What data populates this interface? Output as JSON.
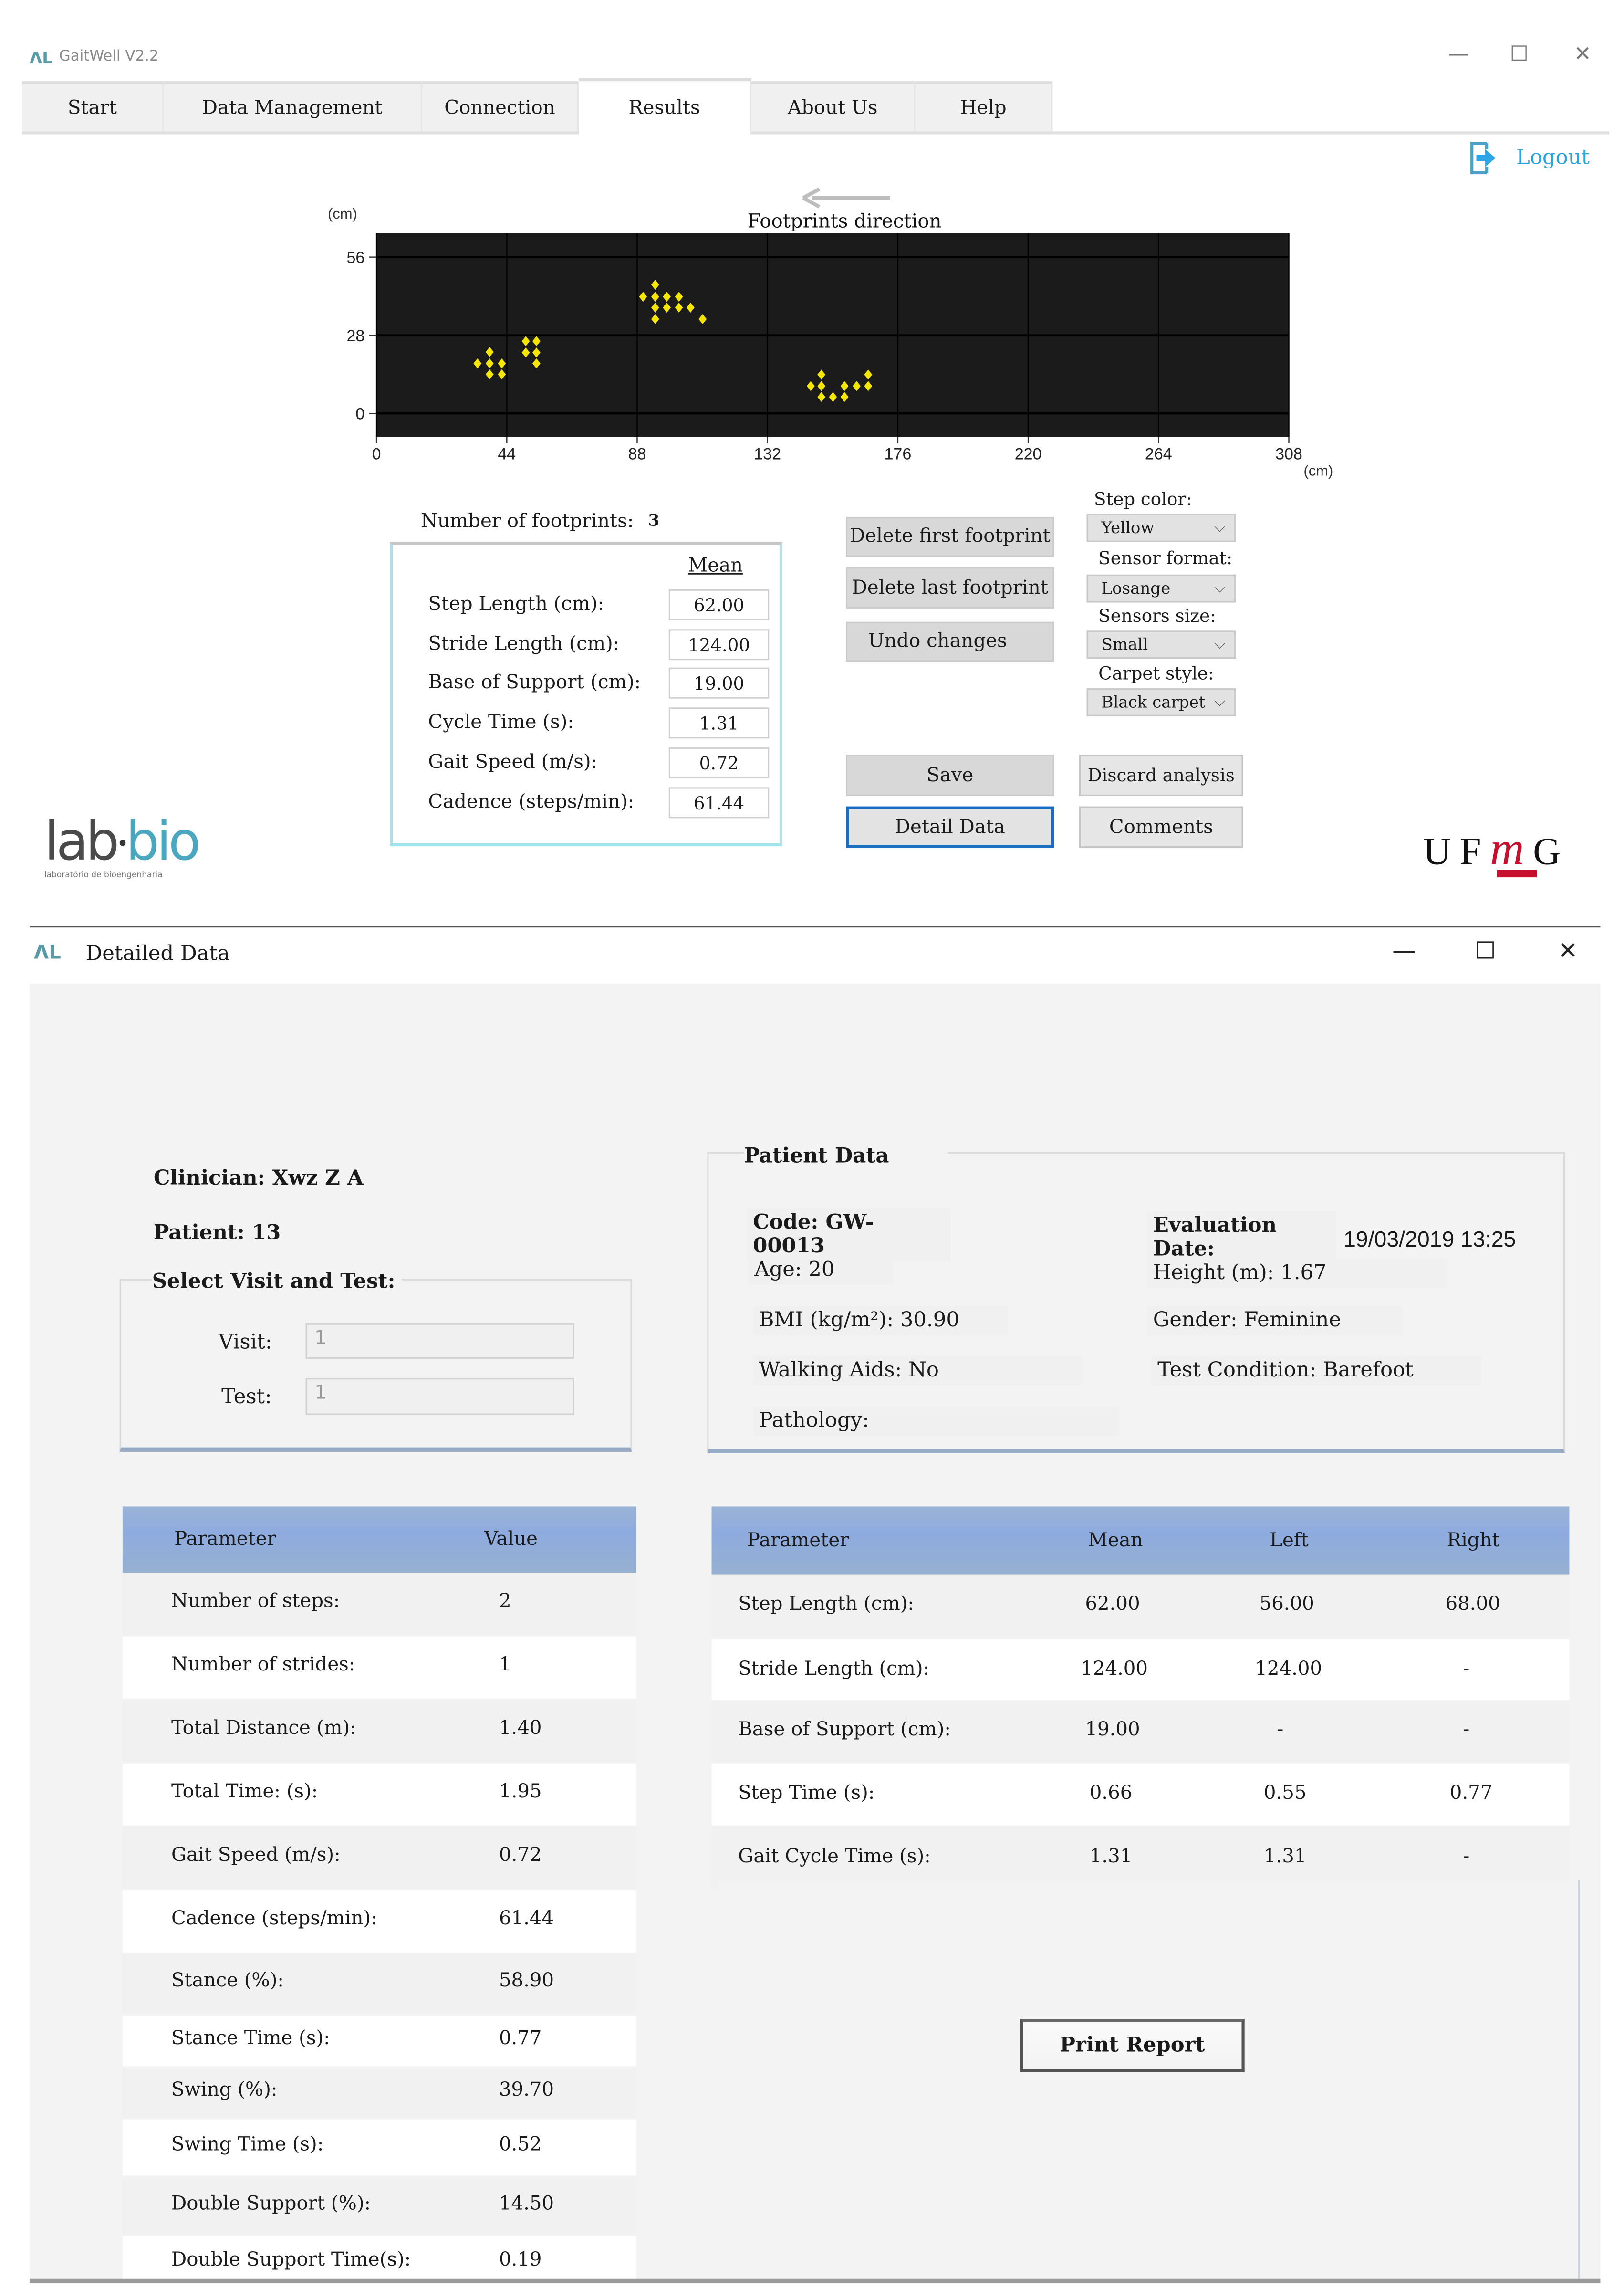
{
  "main_window": {
    "title": "GaitWell V2.2",
    "logo_glyph": "ΛL",
    "controls": {
      "minimize": "—",
      "maximize": "☐",
      "close": "✕"
    },
    "tabs": [
      {
        "label": "Start",
        "active": false
      },
      {
        "label": "Data Management",
        "active": false
      },
      {
        "label": "Connection",
        "active": false
      },
      {
        "label": "Results",
        "active": true
      },
      {
        "label": "About Us",
        "active": false
      },
      {
        "label": "Help",
        "active": false
      }
    ],
    "logout_label": "Logout",
    "footprint_count_label": "Number of footprints:",
    "footprint_count_value": "3",
    "mean_header": "Mean",
    "mean_fields": [
      {
        "label": "Step Length (cm):",
        "value": "62.00"
      },
      {
        "label": "Stride Length (cm):",
        "value": "124.00"
      },
      {
        "label": "Base of Support (cm):",
        "value": "19.00"
      },
      {
        "label": "Cycle Time (s):",
        "value": "1.31"
      },
      {
        "label": "Gait Speed (m/s):",
        "value": "0.72"
      },
      {
        "label": "Cadence (steps/min):",
        "value": "61.44"
      }
    ],
    "buttons": {
      "delete_first": "Delete first footprint",
      "delete_last": "Delete last footprint",
      "undo": "Undo changes",
      "save": "Save",
      "detail_data": "Detail Data",
      "discard": "Discard analysis",
      "comments": "Comments"
    },
    "options": [
      {
        "label": "Step color:",
        "value": "Yellow"
      },
      {
        "label": "Sensor format:",
        "value": "Losange"
      },
      {
        "label": "Sensors size:",
        "value": "Small"
      },
      {
        "label": "Carpet style:",
        "value": "Black carpet"
      }
    ],
    "logos": {
      "labbio_lab": "lab",
      "labbio_dot": "•",
      "labbio_bio": "bio",
      "labbio_sub": "laboratório de bioengenharia",
      "ufmg_u": "U",
      "ufmg_f": "F",
      "ufmg_m": "m",
      "ufmg_g": "G"
    },
    "colors": {
      "accent": "#29a3dc",
      "step": "#f5e600",
      "carpet": "#1b1b1b",
      "ufmg_red": "#c8102e"
    }
  },
  "chart_data": {
    "type": "scatter",
    "title": "Footprints direction",
    "direction_arrow": "←",
    "xlabel": "(cm)",
    "ylabel": "(cm)",
    "xlim": [
      0,
      308
    ],
    "ylim": [
      -8.5,
      64.5
    ],
    "xticks": [
      0,
      44,
      88,
      132,
      176,
      220,
      264,
      308
    ],
    "yticks": [
      0,
      28,
      56
    ],
    "grid": true,
    "marker": "diamond",
    "marker_color": "#f5e600",
    "background": "#1b1b1b",
    "series": [
      {
        "name": "footprint-1",
        "points": [
          [
            34.1,
            17.9
          ],
          [
            38.2,
            22.0
          ],
          [
            38.2,
            17.9
          ],
          [
            42.3,
            17.9
          ],
          [
            38.2,
            14.0
          ],
          [
            42.3,
            14.0
          ],
          [
            50.4,
            25.9
          ],
          [
            54.0,
            25.9
          ],
          [
            50.4,
            21.8
          ],
          [
            54.0,
            21.8
          ],
          [
            54.0,
            17.9
          ]
        ]
      },
      {
        "name": "footprint-2",
        "points": [
          [
            94.1,
            46.1
          ],
          [
            90.0,
            41.8
          ],
          [
            94.1,
            41.8
          ],
          [
            98.0,
            41.8
          ],
          [
            102.1,
            41.8
          ],
          [
            94.1,
            37.9
          ],
          [
            98.0,
            37.9
          ],
          [
            102.1,
            37.9
          ],
          [
            106.0,
            37.9
          ],
          [
            94.1,
            33.8
          ],
          [
            110.1,
            33.8
          ]
        ]
      },
      {
        "name": "footprint-3",
        "points": [
          [
            150.2,
            13.9
          ],
          [
            146.6,
            9.8
          ],
          [
            150.2,
            9.8
          ],
          [
            150.2,
            5.9
          ],
          [
            154.1,
            5.9
          ],
          [
            158.0,
            5.9
          ],
          [
            158.0,
            9.8
          ],
          [
            162.1,
            9.8
          ],
          [
            166.0,
            9.8
          ],
          [
            166.0,
            13.9
          ]
        ]
      }
    ]
  },
  "detail_window": {
    "title": "Detailed Data",
    "logo_glyph": "ΛL",
    "controls": {
      "minimize": "—",
      "maximize": "☐",
      "close": "✕"
    },
    "clinician": "Clinician: Xwz Z A",
    "patient": "Patient: 13",
    "select_group_title": "Select Visit and Test:",
    "visit_label": "Visit:",
    "visit_value": "1",
    "test_label": "Test:",
    "test_value": "1",
    "patient_data": {
      "title": "Patient Data",
      "code": "Code: GW-00013",
      "age": "Age: 20",
      "bmi": "BMI (kg/m²):  30.90",
      "walking_aids": "Walking Aids:  No",
      "pathology": "Pathology:",
      "evaluation_date_label": "Evaluation Date:",
      "evaluation_date": "19/03/2019 13:25",
      "height": "Height (m): 1.67",
      "gender": "Gender:  Feminine",
      "test_condition": "Test Condition:  Barefoot"
    },
    "general_table": {
      "headers": [
        "Parameter",
        "Value"
      ],
      "rows": [
        [
          "Number of steps:",
          "2"
        ],
        [
          "Number of strides:",
          "1"
        ],
        [
          "Total Distance (m):",
          "1.40"
        ],
        [
          "Total Time: (s):",
          "1.95"
        ],
        [
          "Gait Speed (m/s):",
          "0.72"
        ],
        [
          "Cadence (steps/min):",
          "61.44"
        ],
        [
          "Stance (%):",
          "58.90"
        ],
        [
          "Stance Time (s):",
          "0.77"
        ],
        [
          "Swing (%):",
          "39.70"
        ],
        [
          "Swing Time (s):",
          "0.52"
        ],
        [
          "Double Support (%):",
          "14.50"
        ],
        [
          "Double Support Time(s):",
          "0.19"
        ]
      ]
    },
    "side_table": {
      "headers": [
        "Parameter",
        "Mean",
        "Left",
        "Right"
      ],
      "rows": [
        [
          "Step Length (cm):",
          "62.00",
          "56.00",
          "68.00"
        ],
        [
          "Stride Length (cm):",
          "124.00",
          "124.00",
          "-"
        ],
        [
          "Base of Support (cm):",
          "19.00",
          "-",
          "-"
        ],
        [
          "Step Time (s):",
          "0.66",
          "0.55",
          "0.77"
        ],
        [
          "Gait Cycle Time (s):",
          "1.31",
          "1.31",
          "-"
        ]
      ]
    },
    "print_report_label": "Print Report"
  }
}
